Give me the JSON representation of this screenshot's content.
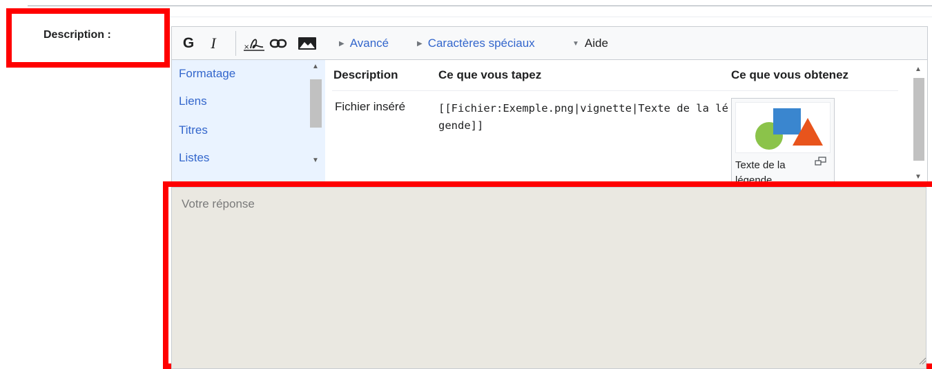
{
  "field": {
    "label": "Description :"
  },
  "toolbar": {
    "bold_label": "G",
    "italic_label": "I",
    "advanced_label": "Avancé",
    "special_chars_label": "Caractères spéciaux",
    "help_label": "Aide"
  },
  "help": {
    "nav": [
      "Formatage",
      "Liens",
      "Titres",
      "Listes"
    ],
    "columns": {
      "description": "Description",
      "you_type": "Ce que vous tapez",
      "you_get": "Ce que vous obtenez"
    },
    "row": {
      "description": "Fichier inséré",
      "code": "[[Fichier:Exemple.png|vignette|Texte de la légende]]",
      "caption": "Texte de la légende"
    }
  },
  "answer": {
    "placeholder": "Votre réponse",
    "value": ""
  },
  "colors": {
    "highlight": "#ff0000",
    "link": "#3366cc",
    "nav_bg": "#eaf3ff",
    "answer_bg": "#eae8e1"
  }
}
